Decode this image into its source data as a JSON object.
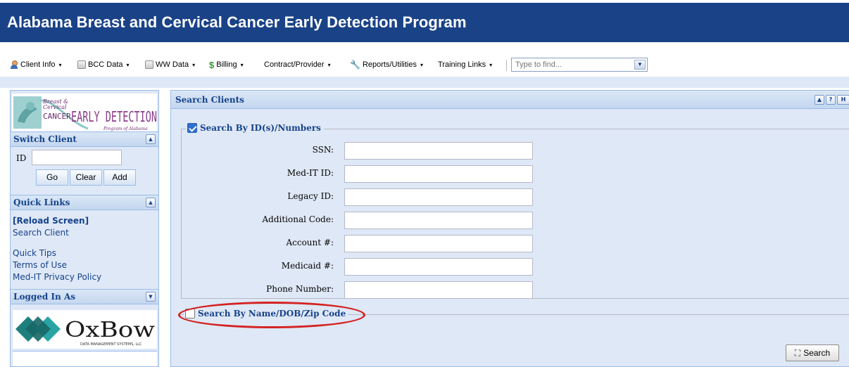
{
  "header": {
    "title": "Alabama Breast and Cervical Cancer Early Detection Program"
  },
  "menu": {
    "items": [
      {
        "label": "Client Info",
        "icon": "person-icon"
      },
      {
        "label": "BCC Data",
        "icon": "database-icon"
      },
      {
        "label": "WW Data",
        "icon": "database-icon"
      },
      {
        "label": "Billing",
        "icon": "dollar-icon"
      },
      {
        "label": "Contract/Provider",
        "icon": ""
      },
      {
        "label": "Reports/Utilities",
        "icon": "wrench-icon"
      },
      {
        "label": "Training Links",
        "icon": ""
      }
    ],
    "find_placeholder": "Type to find..."
  },
  "sidebar": {
    "logo": {
      "small_line1": "Breast &",
      "small_line2": "Cervical",
      "cancer": "CANCER",
      "early_detection": "EARLY DETECTION",
      "program": "Program of Alabama"
    },
    "switch_client": {
      "title": "Switch Client",
      "id_label": "ID",
      "id_value": "",
      "go_label": "Go",
      "clear_label": "Clear",
      "add_label": "Add"
    },
    "quick_links": {
      "title": "Quick Links",
      "reload": "[Reload Screen]",
      "search_client": "Search Client",
      "quick_tips": "Quick Tips",
      "terms": "Terms of Use",
      "privacy": "Med-IT Privacy Policy"
    },
    "logged_in": {
      "title": "Logged In As",
      "company_name": "OxBow",
      "company_sub": "DATA MANAGEMENT SYSTEMS, LLC"
    }
  },
  "panel": {
    "title": "Search Clients",
    "tools": [
      "▲",
      "?",
      "H"
    ],
    "by_id": {
      "legend": "Search By ID(s)/Numbers",
      "checked": true,
      "fields": [
        {
          "label": "SSN:",
          "value": ""
        },
        {
          "label": "Med-IT ID:",
          "value": ""
        },
        {
          "label": "Legacy ID:",
          "value": ""
        },
        {
          "label": "Additional Code:",
          "value": ""
        },
        {
          "label": "Account #:",
          "value": ""
        },
        {
          "label": "Medicaid #:",
          "value": ""
        },
        {
          "label": "Phone Number:",
          "value": ""
        }
      ]
    },
    "by_name": {
      "legend": "Search By Name/DOB/Zip Code",
      "checked": false
    },
    "search_label": "Search"
  },
  "colors": {
    "header": "#1a4287",
    "panel_bg": "#dfe8f6",
    "title_text": "#15428b",
    "highlight": "#d42222"
  }
}
